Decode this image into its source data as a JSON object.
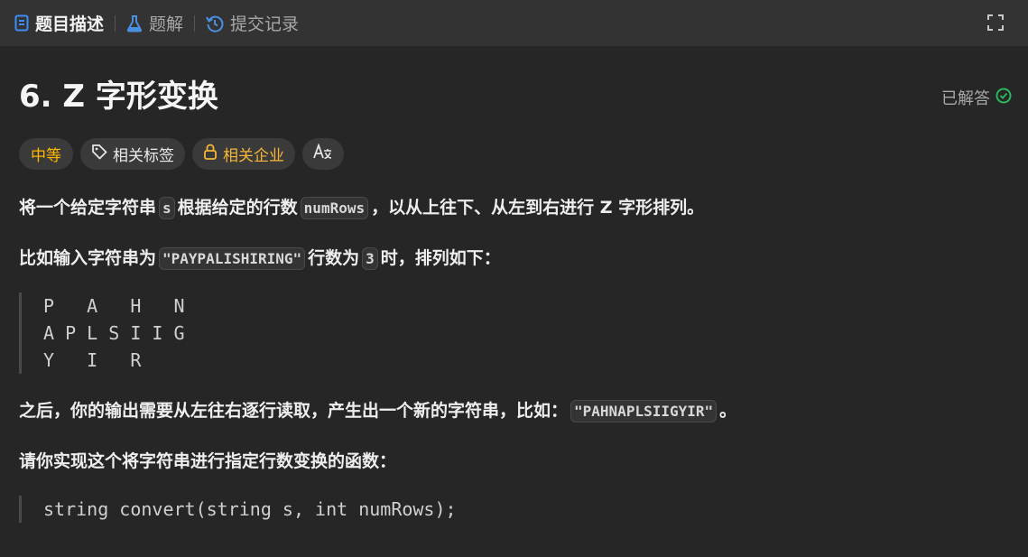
{
  "tabs": [
    {
      "label": "题目描述",
      "icon": "document-icon",
      "active": true
    },
    {
      "label": "题解",
      "icon": "flask-icon",
      "active": false
    },
    {
      "label": "提交记录",
      "icon": "history-icon",
      "active": false
    }
  ],
  "problem": {
    "title": "6. Z 字形变换",
    "status": "已解答",
    "tags": {
      "difficulty": "中等",
      "related_tags": "相关标签",
      "related_companies": "相关企业",
      "translate": "A文"
    }
  },
  "description": {
    "p1": {
      "t1": "将一个给定字符串",
      "c1": "s",
      "t2": "根据给定的行数",
      "c2": "numRows",
      "t3": "，以从上往下、从左到右进行 Z 字形排列。"
    },
    "p2": {
      "t1": "比如输入字符串为",
      "c1": "\"PAYPALISHIRING\"",
      "t2": "行数为",
      "c2": "3",
      "t3": "时，排列如下："
    },
    "example_lines": [
      "P   A   H   N",
      "A P L S I I G",
      "Y   I   R"
    ],
    "p3": {
      "t1": "之后，你的输出需要从左往右逐行读取，产生出一个新的字符串，比如：",
      "c1": "\"PAHNAPLSIIGYIR\"",
      "t2": "。"
    },
    "p4": "请你实现这个将字符串进行指定行数变换的函数：",
    "signature": "string convert(string s, int numRows);"
  },
  "colors": {
    "background": "#262626",
    "tabbar": "#333333",
    "difficulty_medium": "#ffb800",
    "solved_check": "#2db55d"
  }
}
